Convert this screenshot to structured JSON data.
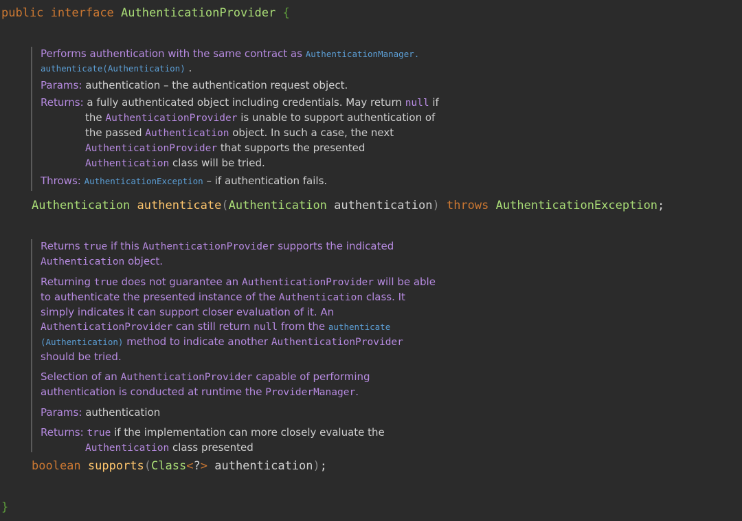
{
  "header": {
    "kw1": "public",
    "kw2": "interface",
    "name": "AuthenticationProvider",
    "open_brace": "{"
  },
  "doc1": {
    "p1_a": "Performs authentication with the same contract as ",
    "p1_link1": "AuthenticationManager.",
    "p1_link2": "authenticate(Authentication)",
    "p1_end": " .",
    "params_label": "Params:",
    "params_name": "authentication",
    "params_rest": " – the authentication request object.",
    "returns_label": "Returns:",
    "returns_1": " a fully authenticated object including credentials. May return ",
    "returns_null": "null",
    "returns_2": " if the ",
    "returns_code1": "AuthenticationProvider",
    "returns_3": " is unable to support authentication of the passed ",
    "returns_code2": "Authentication",
    "returns_4": " object. In such a case, the next ",
    "returns_code3": "AuthenticationProvider",
    "returns_5": " that supports the presented ",
    "returns_code4": "Authentication",
    "returns_6": " class will be tried.",
    "throws_label": "Throws:",
    "throws_link": "AuthenticationException",
    "throws_rest": " – if authentication fails."
  },
  "method1": {
    "ret": "Authentication",
    "name": "authenticate",
    "lparen": "(",
    "ptype": "Authentication",
    "pname": "authentication",
    "rparen": ")",
    "throws": "throws",
    "ex": "AuthenticationException",
    "semi": ";"
  },
  "doc2": {
    "p1_a": "Returns ",
    "p1_true": "true",
    "p1_b": " if this ",
    "p1_code": "AuthenticationProvider",
    "p1_c": " supports the indicated ",
    "p1_code2": "Authentication",
    "p1_d": " object.",
    "p2_a": "Returning ",
    "p2_true": "true",
    "p2_b": " does not guarantee an ",
    "p2_code": "AuthenticationProvider",
    "p2_c": " will be able to authenticate the presented instance of the ",
    "p2_code2": "Authentication",
    "p2_d": " class. It simply indicates it can support closer evaluation of it. An ",
    "p2_code3": "AuthenticationProvider",
    "p2_e": " can still return ",
    "p2_null": "null",
    "p2_f": " from the ",
    "p2_link1": "authenticate",
    "p2_link2": "(Authentication)",
    "p2_g": " method to indicate another ",
    "p2_code4": "AuthenticationProvider",
    "p2_h": " should be tried.",
    "p3_a": "Selection of an ",
    "p3_code": "AuthenticationProvider",
    "p3_b": " capable of performing authentication is conducted at runtime the ",
    "p3_code2": "ProviderManager",
    "p3_c": ".",
    "params_label": "Params:",
    "params_name": "authentication",
    "returns_label": "Returns:",
    "returns_true": "true",
    "returns_a": " if the implementation can more closely evaluate the ",
    "returns_code": "Authentication",
    "returns_b": " class presented"
  },
  "method2": {
    "ret": "boolean",
    "name": "supports",
    "lparen": "(",
    "ptype": "Class",
    "lt": "<",
    "q": "?",
    "gt": ">",
    "pname": "authentication",
    "rparen": ")",
    "semi": ";"
  },
  "footer": {
    "close_brace": "}"
  },
  "colors": {
    "background": "#2b2b2b",
    "keyword": "#cc7832",
    "class_name": "#a9dc76",
    "method": "#ffc66d",
    "doc_text": "#b68ae0",
    "link": "#5c9fd6"
  }
}
